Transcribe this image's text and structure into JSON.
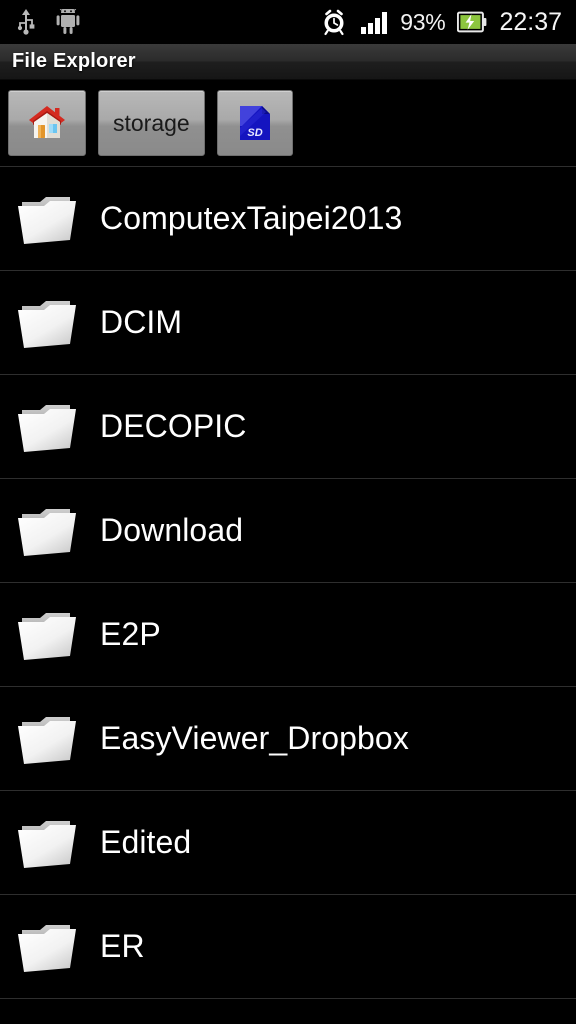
{
  "status_bar": {
    "left_icons": [
      {
        "name": "usb-icon",
        "label": "USB connected"
      },
      {
        "name": "android-icon",
        "label": "Android system"
      }
    ],
    "alarm_icon": "alarm-clock-icon",
    "signal_icon": "signal-bars-icon",
    "signal_bars": 4,
    "battery_percent": "93%",
    "battery_icon": "battery-charging-icon",
    "time": "22:37"
  },
  "title_bar": {
    "title": "File Explorer"
  },
  "breadcrumb": {
    "items": [
      {
        "type": "icon",
        "icon": "home-icon",
        "label": "Home"
      },
      {
        "type": "text",
        "icon": "",
        "label": "storage"
      },
      {
        "type": "icon",
        "icon": "sd-card-icon",
        "label": "SD card"
      }
    ]
  },
  "file_list": {
    "items": [
      {
        "name": "ComputexTaipei2013",
        "icon": "folder-icon"
      },
      {
        "name": "DCIM",
        "icon": "folder-icon"
      },
      {
        "name": "DECOPIC",
        "icon": "folder-icon"
      },
      {
        "name": "Download",
        "icon": "folder-icon"
      },
      {
        "name": "E2P",
        "icon": "folder-icon"
      },
      {
        "name": "EasyViewer_Dropbox",
        "icon": "folder-icon"
      },
      {
        "name": "Edited",
        "icon": "folder-icon"
      },
      {
        "name": "ER",
        "icon": "folder-icon"
      }
    ]
  },
  "colors": {
    "background": "#000000",
    "divider": "#2e2e2e",
    "text": "#ffffff",
    "button_face": "#a9a9a9",
    "battery_green": "#8dc63f",
    "sd_blue": "#1c1cc8",
    "roof_red": "#cc2222"
  }
}
